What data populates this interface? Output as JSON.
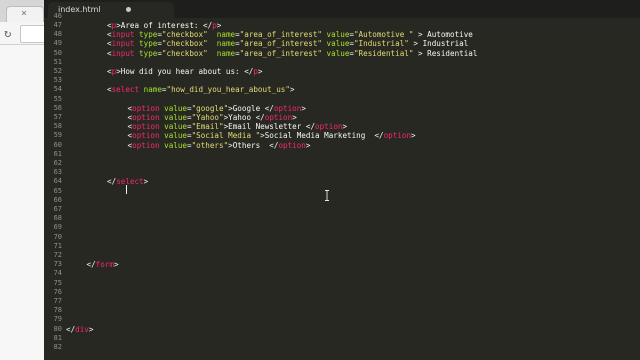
{
  "tab": {
    "filename": "index.html"
  },
  "gutter_top_partial": "46",
  "lines": [
    {
      "n": "47",
      "indent": 8,
      "tokens": [
        {
          "k": "txt",
          "v": "<"
        },
        {
          "k": "tag",
          "v": "p"
        },
        {
          "k": "txt",
          "v": ">Area of interest: </"
        },
        {
          "k": "tag",
          "v": "p"
        },
        {
          "k": "txt",
          "v": ">"
        }
      ]
    },
    {
      "n": "48",
      "indent": 8,
      "tokens": [
        {
          "k": "txt",
          "v": "<"
        },
        {
          "k": "tag",
          "v": "input"
        },
        {
          "k": "txt",
          "v": " "
        },
        {
          "k": "attr",
          "v": "type"
        },
        {
          "k": "txt",
          "v": "="
        },
        {
          "k": "str",
          "v": "\"checkbox\""
        },
        {
          "k": "txt",
          "v": "  "
        },
        {
          "k": "attr",
          "v": "name"
        },
        {
          "k": "txt",
          "v": "="
        },
        {
          "k": "str",
          "v": "\"area_of_interest\""
        },
        {
          "k": "txt",
          "v": " "
        },
        {
          "k": "attr",
          "v": "value"
        },
        {
          "k": "txt",
          "v": "="
        },
        {
          "k": "str",
          "v": "\"Automotive \""
        },
        {
          "k": "txt",
          "v": " > Automotive"
        }
      ]
    },
    {
      "n": "49",
      "indent": 8,
      "tokens": [
        {
          "k": "txt",
          "v": "<"
        },
        {
          "k": "tag",
          "v": "input"
        },
        {
          "k": "txt",
          "v": " "
        },
        {
          "k": "attr",
          "v": "type"
        },
        {
          "k": "txt",
          "v": "="
        },
        {
          "k": "str",
          "v": "\"checkbox\""
        },
        {
          "k": "txt",
          "v": "  "
        },
        {
          "k": "attr",
          "v": "name"
        },
        {
          "k": "txt",
          "v": "="
        },
        {
          "k": "str",
          "v": "\"area_of_interest\""
        },
        {
          "k": "txt",
          "v": " "
        },
        {
          "k": "attr",
          "v": "value"
        },
        {
          "k": "txt",
          "v": "="
        },
        {
          "k": "str",
          "v": "\"Industrial\""
        },
        {
          "k": "txt",
          "v": " > Industrial"
        }
      ]
    },
    {
      "n": "50",
      "indent": 8,
      "tokens": [
        {
          "k": "txt",
          "v": "<"
        },
        {
          "k": "tag",
          "v": "input"
        },
        {
          "k": "txt",
          "v": " "
        },
        {
          "k": "attr",
          "v": "type"
        },
        {
          "k": "txt",
          "v": "="
        },
        {
          "k": "str",
          "v": "\"checkbox\""
        },
        {
          "k": "txt",
          "v": "  "
        },
        {
          "k": "attr",
          "v": "name"
        },
        {
          "k": "txt",
          "v": "="
        },
        {
          "k": "str",
          "v": "\"area_of_interest\""
        },
        {
          "k": "txt",
          "v": " "
        },
        {
          "k": "attr",
          "v": "value"
        },
        {
          "k": "txt",
          "v": "="
        },
        {
          "k": "str",
          "v": "\"Residential\""
        },
        {
          "k": "txt",
          "v": " > Residential"
        }
      ]
    },
    {
      "n": "51",
      "indent": 0,
      "tokens": []
    },
    {
      "n": "52",
      "indent": 8,
      "tokens": [
        {
          "k": "txt",
          "v": "<"
        },
        {
          "k": "tag",
          "v": "p"
        },
        {
          "k": "txt",
          "v": ">How did you hear about us: </"
        },
        {
          "k": "tag",
          "v": "p"
        },
        {
          "k": "txt",
          "v": ">"
        }
      ]
    },
    {
      "n": "53",
      "indent": 0,
      "tokens": []
    },
    {
      "n": "54",
      "indent": 8,
      "tokens": [
        {
          "k": "txt",
          "v": "<"
        },
        {
          "k": "tag",
          "v": "select"
        },
        {
          "k": "txt",
          "v": " "
        },
        {
          "k": "attr",
          "v": "name"
        },
        {
          "k": "txt",
          "v": "="
        },
        {
          "k": "str",
          "v": "\"how_did_you_hear_about_us\""
        },
        {
          "k": "txt",
          "v": ">"
        }
      ]
    },
    {
      "n": "55",
      "indent": 0,
      "tokens": []
    },
    {
      "n": "56",
      "indent": 12,
      "tokens": [
        {
          "k": "txt",
          "v": "<"
        },
        {
          "k": "tag",
          "v": "option"
        },
        {
          "k": "txt",
          "v": " "
        },
        {
          "k": "attr",
          "v": "value"
        },
        {
          "k": "txt",
          "v": "="
        },
        {
          "k": "str",
          "v": "\"google\""
        },
        {
          "k": "txt",
          "v": ">Google </"
        },
        {
          "k": "tag",
          "v": "option"
        },
        {
          "k": "txt",
          "v": ">"
        }
      ]
    },
    {
      "n": "57",
      "indent": 12,
      "tokens": [
        {
          "k": "txt",
          "v": "<"
        },
        {
          "k": "tag",
          "v": "option"
        },
        {
          "k": "txt",
          "v": " "
        },
        {
          "k": "attr",
          "v": "value"
        },
        {
          "k": "txt",
          "v": "="
        },
        {
          "k": "str",
          "v": "\"Yahoo\""
        },
        {
          "k": "txt",
          "v": ">Yahoo </"
        },
        {
          "k": "tag",
          "v": "option"
        },
        {
          "k": "txt",
          "v": ">"
        }
      ]
    },
    {
      "n": "58",
      "indent": 12,
      "tokens": [
        {
          "k": "txt",
          "v": "<"
        },
        {
          "k": "tag",
          "v": "option"
        },
        {
          "k": "txt",
          "v": " "
        },
        {
          "k": "attr",
          "v": "value"
        },
        {
          "k": "txt",
          "v": "="
        },
        {
          "k": "str",
          "v": "\"Email\""
        },
        {
          "k": "txt",
          "v": ">Email Newsletter </"
        },
        {
          "k": "tag",
          "v": "option"
        },
        {
          "k": "txt",
          "v": ">"
        }
      ]
    },
    {
      "n": "59",
      "indent": 12,
      "tokens": [
        {
          "k": "txt",
          "v": "<"
        },
        {
          "k": "tag",
          "v": "option"
        },
        {
          "k": "txt",
          "v": " "
        },
        {
          "k": "attr",
          "v": "value"
        },
        {
          "k": "txt",
          "v": "="
        },
        {
          "k": "str",
          "v": "\"Social Media \""
        },
        {
          "k": "txt",
          "v": ">Social Media Marketing  </"
        },
        {
          "k": "tag",
          "v": "option"
        },
        {
          "k": "txt",
          "v": ">"
        }
      ]
    },
    {
      "n": "60",
      "indent": 12,
      "tokens": [
        {
          "k": "txt",
          "v": "<"
        },
        {
          "k": "tag",
          "v": "option"
        },
        {
          "k": "txt",
          "v": " "
        },
        {
          "k": "attr",
          "v": "value"
        },
        {
          "k": "txt",
          "v": "="
        },
        {
          "k": "str",
          "v": "\"others\""
        },
        {
          "k": "txt",
          "v": ">Others  </"
        },
        {
          "k": "tag",
          "v": "option"
        },
        {
          "k": "txt",
          "v": ">"
        }
      ]
    },
    {
      "n": "61",
      "indent": 0,
      "tokens": []
    },
    {
      "n": "62",
      "indent": 0,
      "tokens": []
    },
    {
      "n": "63",
      "indent": 0,
      "tokens": []
    },
    {
      "n": "64",
      "indent": 8,
      "tokens": [
        {
          "k": "txt",
          "v": "</"
        },
        {
          "k": "tag",
          "v": "select"
        },
        {
          "k": "txt",
          "v": ">"
        }
      ]
    },
    {
      "n": "65",
      "indent": 0,
      "tokens": []
    },
    {
      "n": "66",
      "indent": 0,
      "tokens": []
    },
    {
      "n": "67",
      "indent": 0,
      "tokens": []
    },
    {
      "n": "68",
      "indent": 0,
      "tokens": []
    },
    {
      "n": "69",
      "indent": 0,
      "tokens": []
    },
    {
      "n": "70",
      "indent": 0,
      "tokens": []
    },
    {
      "n": "71",
      "indent": 0,
      "tokens": []
    },
    {
      "n": "72",
      "indent": 0,
      "tokens": []
    },
    {
      "n": "73",
      "indent": 4,
      "tokens": [
        {
          "k": "txt",
          "v": "</"
        },
        {
          "k": "tag",
          "v": "form"
        },
        {
          "k": "txt",
          "v": ">"
        }
      ]
    },
    {
      "n": "74",
      "indent": 0,
      "tokens": []
    },
    {
      "n": "75",
      "indent": 0,
      "tokens": []
    },
    {
      "n": "76",
      "indent": 0,
      "tokens": []
    },
    {
      "n": "77",
      "indent": 0,
      "tokens": []
    },
    {
      "n": "78",
      "indent": 0,
      "tokens": []
    },
    {
      "n": "79",
      "indent": 0,
      "tokens": []
    },
    {
      "n": "80",
      "indent": 0,
      "tokens": [
        {
          "k": "txt",
          "v": "</"
        },
        {
          "k": "tag",
          "v": "div"
        },
        {
          "k": "txt",
          "v": ">"
        }
      ]
    },
    {
      "n": "81",
      "indent": 0,
      "tokens": []
    },
    {
      "n": "82",
      "indent": 0,
      "tokens": []
    }
  ],
  "colors": {
    "background": "#272822",
    "tag": "#f92672",
    "attribute": "#a6e22e",
    "string": "#e6db74",
    "text": "#f8f8f2",
    "line_number": "#8f908a"
  },
  "icons": {
    "tab_dirty": "unsaved-dot-icon",
    "browser_reload": "reload-icon",
    "mouse_cursor": "text-cursor-icon"
  }
}
